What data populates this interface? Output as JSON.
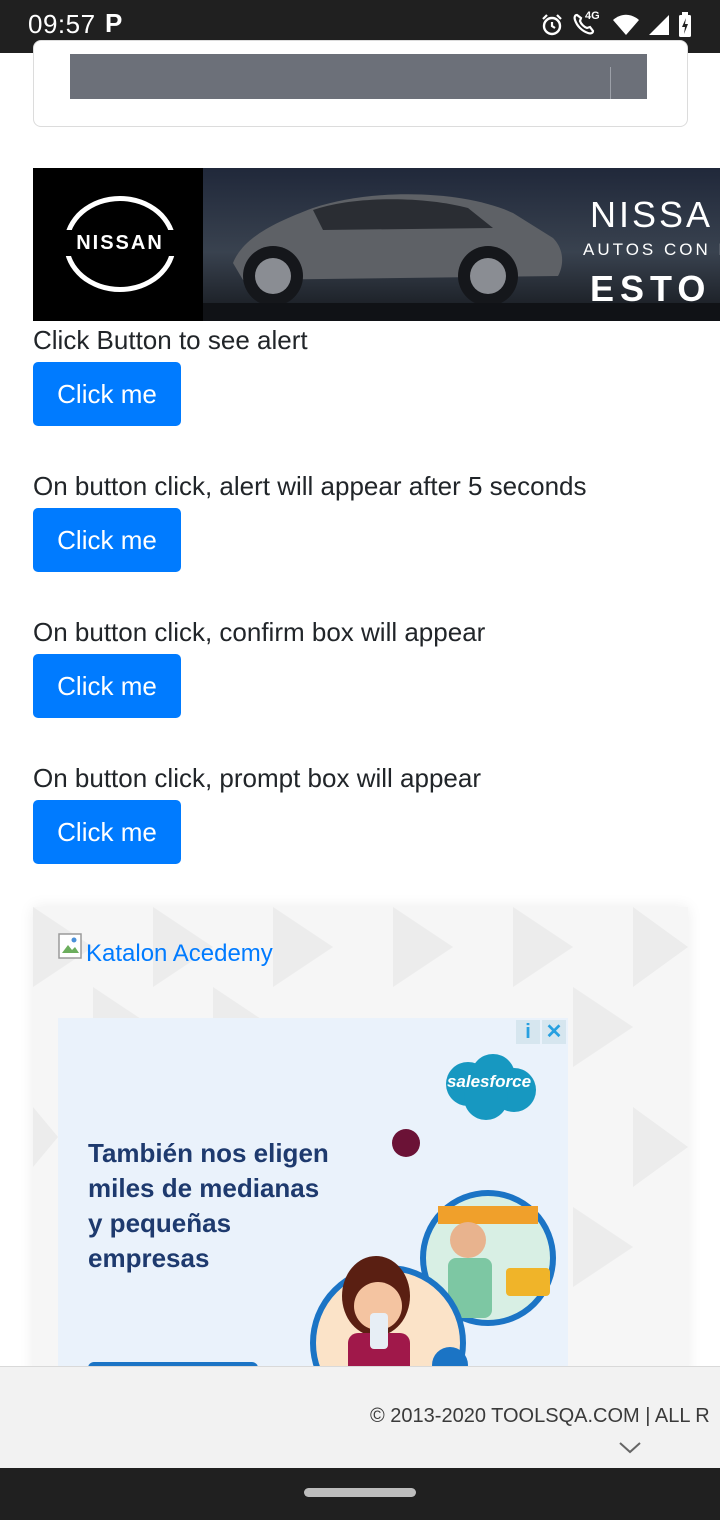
{
  "status_bar": {
    "time": "09:57",
    "app_indicator": "P",
    "network": "4G",
    "icons": [
      "alarm-icon",
      "wifi-calling-icon",
      "wifi-icon",
      "cell-signal-icon",
      "battery-icon"
    ]
  },
  "colors": {
    "primary_button": "#007bff",
    "link": "#007bff",
    "status_bar": "#202020"
  },
  "nissan_ad": {
    "logo_text": "NISSAN",
    "brand": "NISSA",
    "tagline": "AUTOS CON L",
    "sub": "ESTO"
  },
  "alerts": [
    {
      "label": "Click Button to see alert",
      "button_label": "Click me"
    },
    {
      "label": "On button click, alert will appear after 5 seconds",
      "button_label": "Click me"
    },
    {
      "label": "On button click, confirm box will appear",
      "button_label": "Click me"
    },
    {
      "label": "On button click, prompt box will appear",
      "button_label": "Click me"
    }
  ],
  "katalon_ad": {
    "link_text": "Katalon Acedemy",
    "salesforce_logo": "salesforce",
    "headline_lines": [
      "También nos eligen",
      "miles de medianas",
      "y pequeñas",
      "empresas"
    ],
    "adchoices": [
      "i",
      "✕"
    ]
  },
  "footer": {
    "copyright": "© 2013-2020 TOOLSQA.COM | ALL R"
  }
}
